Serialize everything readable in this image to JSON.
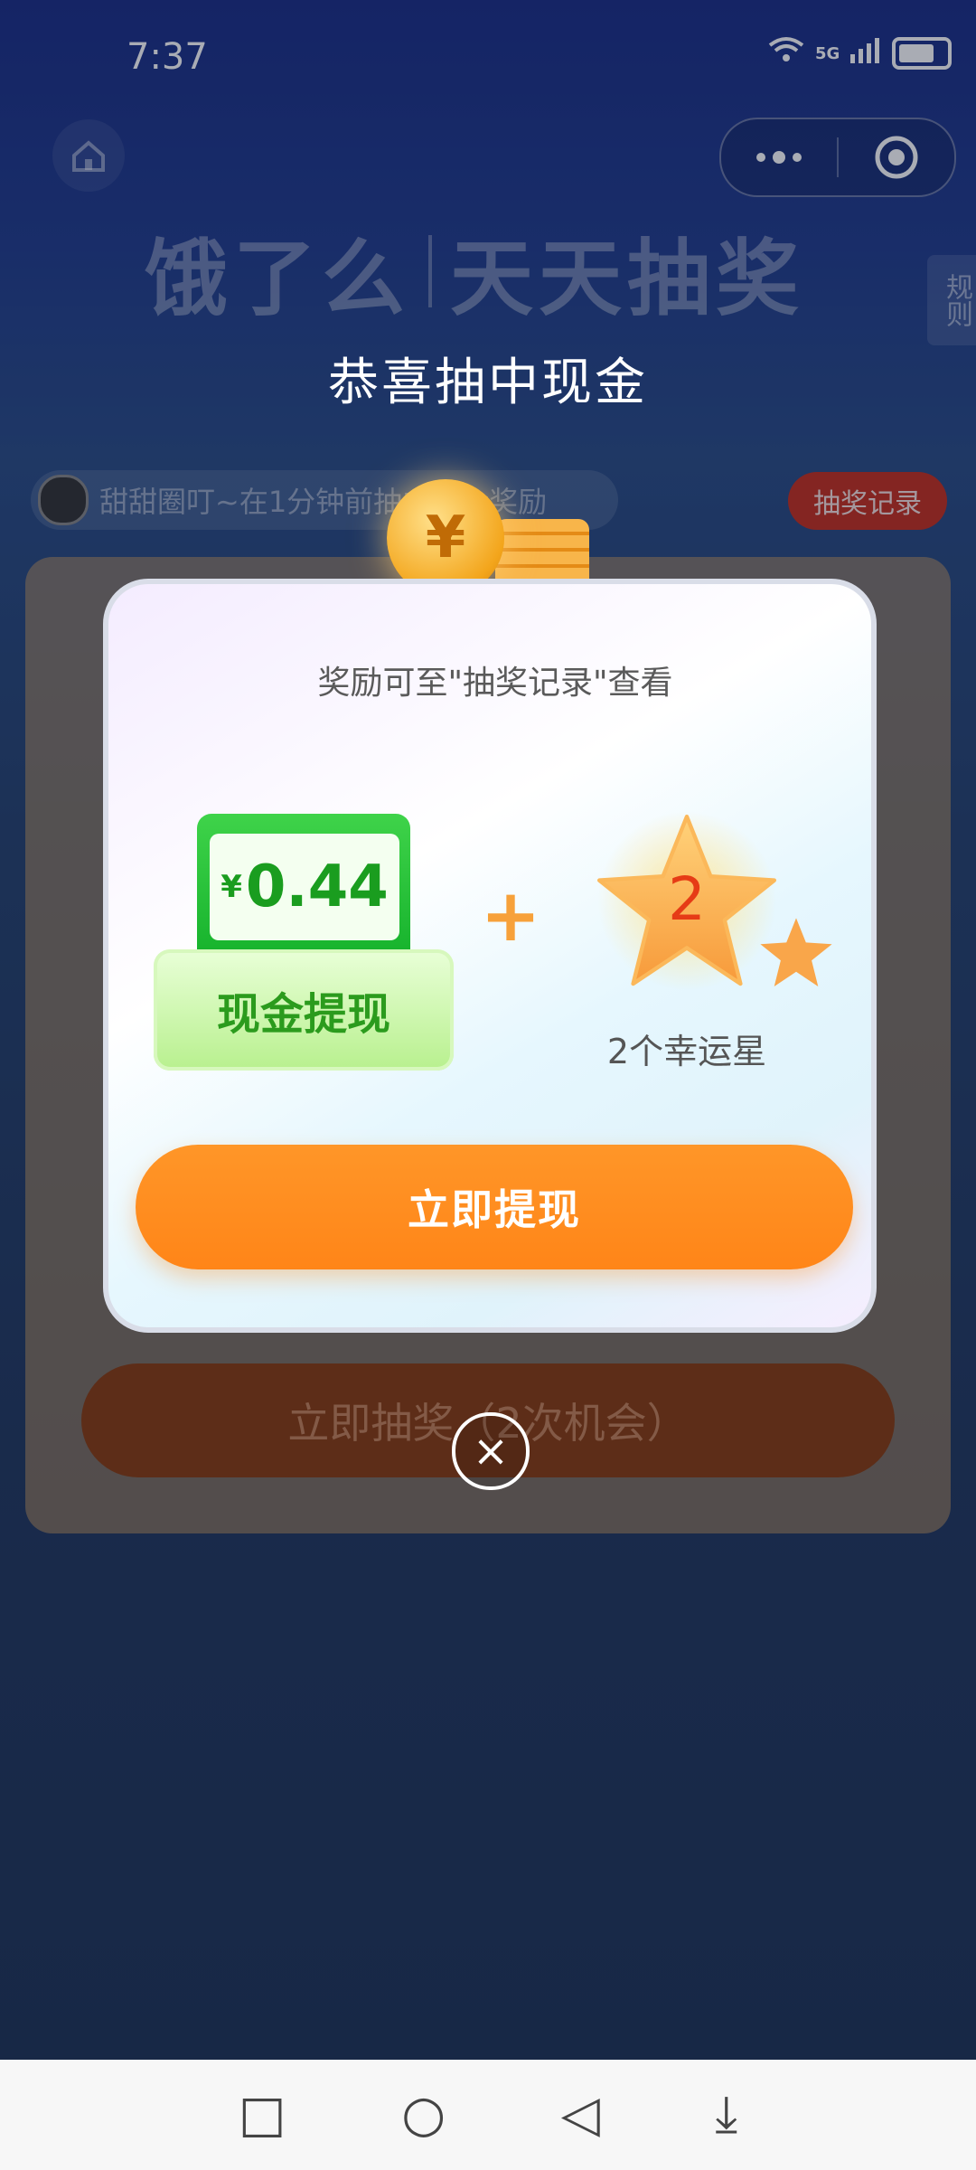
{
  "status_bar": {
    "time": "7:37",
    "network": "5G"
  },
  "background": {
    "brand_logo_text": "饿了么",
    "brand_title": "天天抽奖",
    "rules_tab": "规则",
    "ticker_text": "甜甜圈叮~在1分钟前抽中现金奖励",
    "records_button": "抽奖记录",
    "draw_button": "立即抽奖（2次机会）"
  },
  "popup": {
    "title": "恭喜抽中现金",
    "subtitle": "奖励可至\"抽奖记录\"查看",
    "cash": {
      "currency": "¥",
      "amount": "0.44",
      "label": "现金提现"
    },
    "plus": "+",
    "lucky_star": {
      "count": "2",
      "label": "2个幸运星"
    },
    "withdraw_button": "立即提现",
    "close": "×"
  },
  "nav_bar": {
    "recents": "□",
    "home": "○",
    "back": "◁",
    "menu": "⤓"
  },
  "colors": {
    "accent_orange": "#ff8a1f",
    "cash_green": "#1fb02c",
    "star_orange": "#f7a13a",
    "records_red": "#c7311f"
  }
}
